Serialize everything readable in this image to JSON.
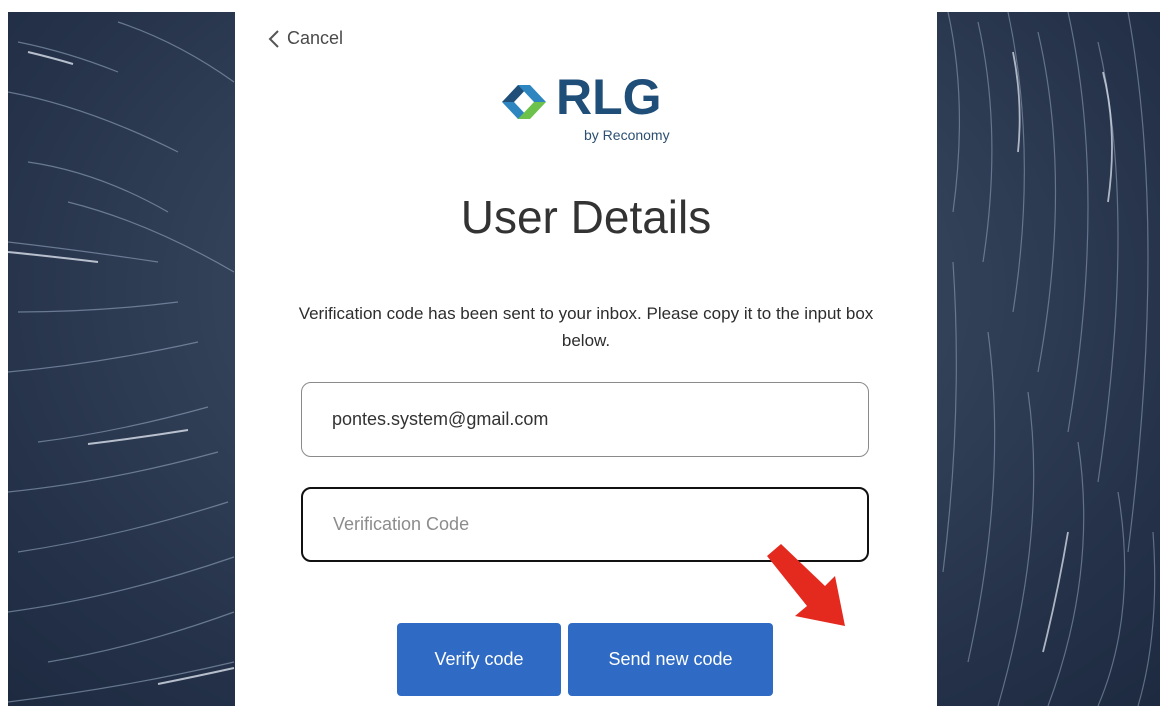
{
  "nav": {
    "cancel_label": "Cancel"
  },
  "logo": {
    "name": "RLG",
    "tagline": "by Reconomy"
  },
  "page": {
    "title": "User Details",
    "message": "Verification code has been sent to your inbox. Please copy it to the input box below."
  },
  "form": {
    "email_value": "pontes.system@gmail.com",
    "code_placeholder": "Verification Code"
  },
  "buttons": {
    "verify_label": "Verify code",
    "send_label": "Send new code"
  },
  "colors": {
    "primary_button": "#2f6bc4",
    "annotation_arrow": "#e42a1f",
    "logo_text": "#1f4e79"
  },
  "icons": {
    "back": "chevron-left-icon",
    "annotation": "red-arrow-icon"
  }
}
